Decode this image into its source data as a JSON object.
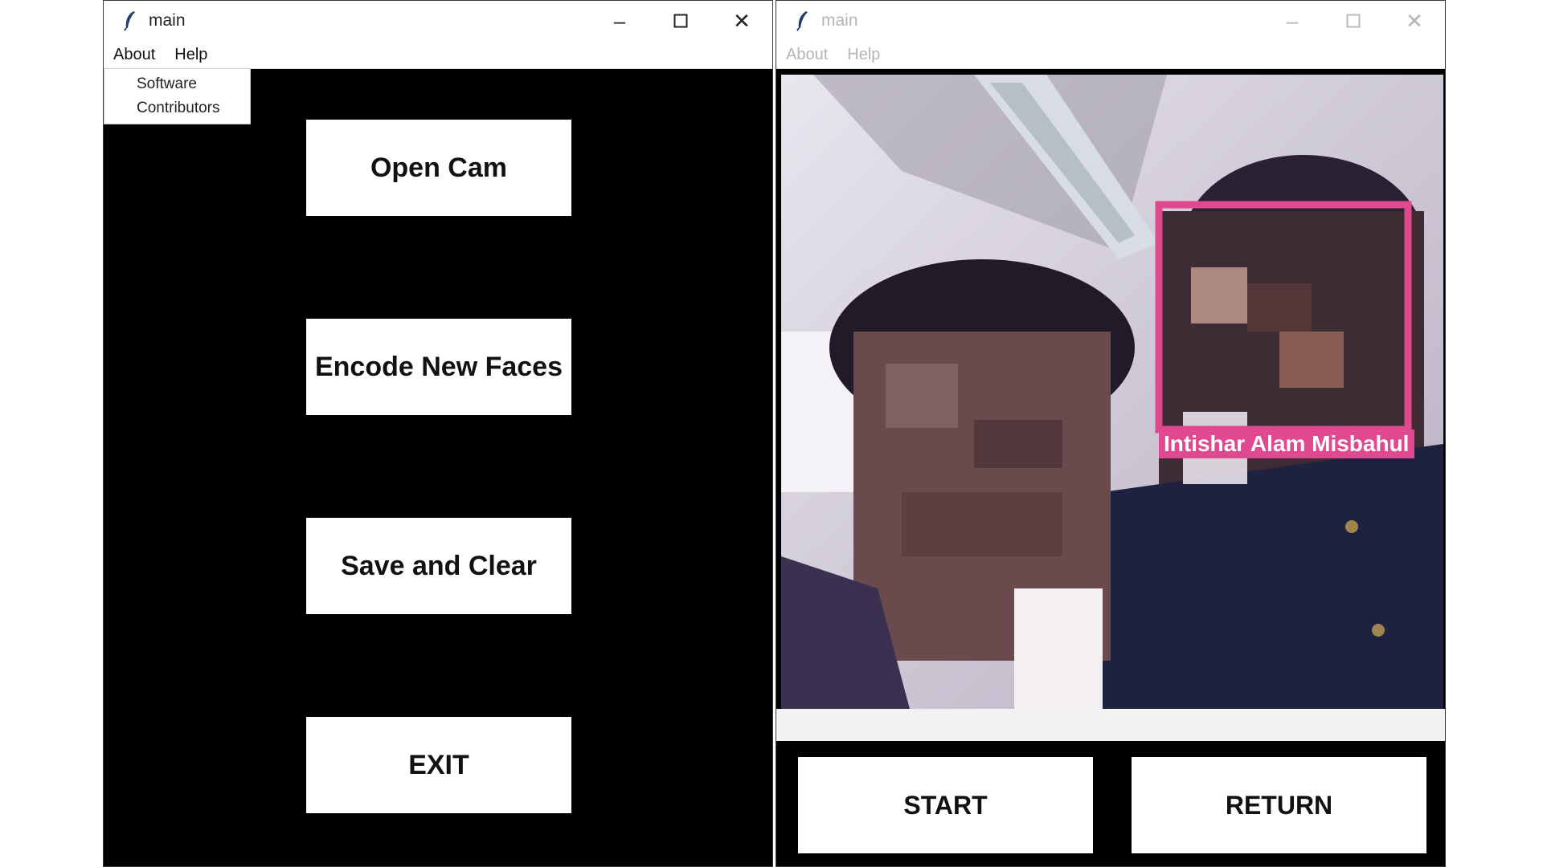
{
  "left_window": {
    "title": "main",
    "menu": [
      "About",
      "Help"
    ],
    "about_dropdown": [
      "Software",
      "Contributors"
    ],
    "buttons": [
      "Open Cam",
      "Encode New Faces",
      "Save and Clear",
      "EXIT"
    ]
  },
  "right_window": {
    "title": "main",
    "menu": [
      "About",
      "Help"
    ],
    "detection_label": "Intishar  Alam  Misbahul",
    "buttons": [
      "START",
      "RETURN"
    ]
  },
  "colors": {
    "background": "#000000",
    "detection_box": "#e0488f",
    "button_bg": "#ffffff"
  },
  "icons": [
    "feather-icon",
    "minimize-icon",
    "maximize-icon",
    "close-icon"
  ]
}
